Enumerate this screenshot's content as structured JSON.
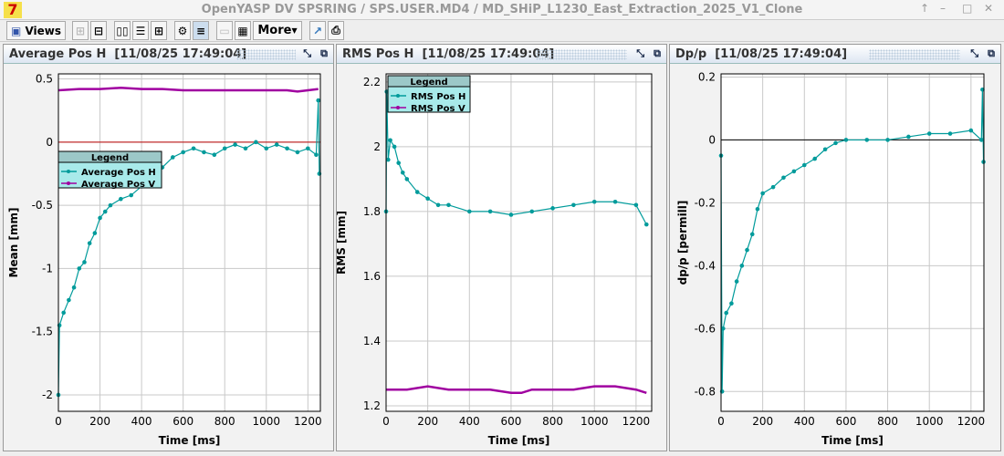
{
  "window": {
    "title": "OpenYASP DV SPSRING / SPS.USER.MD4 / MD_SHiP_L1230_East_Extraction_2025_V1_Clone",
    "controls": [
      "↑",
      "–",
      "□",
      "✕"
    ]
  },
  "toolbar": {
    "views_label": "Views",
    "more_label": "More"
  },
  "panels": [
    {
      "title": "Average Pos H",
      "timestamp": "[11/08/25 17:49:04]"
    },
    {
      "title": "RMS Pos H",
      "timestamp": "[11/08/25 17:49:04]"
    },
    {
      "title": "Dp/p",
      "timestamp": "[11/08/25 17:49:04]"
    }
  ],
  "chart_data": [
    {
      "type": "line",
      "xlabel": "Time [ms]",
      "ylabel": "Mean [mm]",
      "xlim": [
        0,
        1260
      ],
      "ylim": [
        -2.13,
        0.54
      ],
      "xticks": [
        0,
        200,
        400,
        600,
        800,
        1000,
        1200
      ],
      "yticks": [
        0.5,
        0,
        -0.5,
        -1,
        -1.5,
        -2
      ],
      "grid": true,
      "zero_line": true,
      "legend_title": "Legend",
      "legend_placement": "left",
      "series": [
        {
          "name": "Average Pos H",
          "color": "#009b9b",
          "x": [
            0,
            5,
            25,
            50,
            75,
            100,
            125,
            150,
            175,
            200,
            225,
            250,
            300,
            350,
            400,
            450,
            500,
            550,
            600,
            650,
            700,
            750,
            800,
            850,
            900,
            950,
            1000,
            1050,
            1100,
            1150,
            1200,
            1240,
            1250,
            1255
          ],
          "y": [
            -2.0,
            -1.45,
            -1.35,
            -1.25,
            -1.15,
            -1.0,
            -0.95,
            -0.8,
            -0.72,
            -0.6,
            -0.55,
            -0.5,
            -0.45,
            -0.42,
            -0.35,
            -0.3,
            -0.2,
            -0.12,
            -0.08,
            -0.05,
            -0.08,
            -0.1,
            -0.05,
            -0.02,
            -0.05,
            0.0,
            -0.05,
            -0.02,
            -0.05,
            -0.08,
            -0.05,
            -0.1,
            0.33,
            -0.25
          ]
        },
        {
          "name": "Average Pos V",
          "color": "#a000a0",
          "x": [
            0,
            100,
            200,
            300,
            400,
            500,
            600,
            700,
            800,
            900,
            1000,
            1100,
            1150,
            1200,
            1250
          ],
          "y": [
            0.41,
            0.42,
            0.42,
            0.43,
            0.42,
            0.42,
            0.41,
            0.41,
            0.41,
            0.41,
            0.41,
            0.41,
            0.4,
            0.41,
            0.42
          ]
        }
      ]
    },
    {
      "type": "line",
      "xlabel": "Time [ms]",
      "ylabel": "RMS [mm]",
      "xlim": [
        0,
        1275
      ],
      "ylim": [
        1.183,
        2.225
      ],
      "xticks": [
        0,
        200,
        400,
        600,
        800,
        1000,
        1200
      ],
      "yticks": [
        2.2,
        2,
        1.8,
        1.6,
        1.4,
        1.2
      ],
      "grid": true,
      "legend_title": "Legend",
      "legend_placement": "top-left",
      "series": [
        {
          "name": "RMS Pos H",
          "color": "#009b9b",
          "x": [
            0,
            3,
            10,
            20,
            40,
            60,
            80,
            100,
            150,
            200,
            250,
            300,
            400,
            500,
            600,
            700,
            800,
            900,
            1000,
            1100,
            1200,
            1250
          ],
          "y": [
            1.8,
            2.17,
            1.96,
            2.02,
            2.0,
            1.95,
            1.92,
            1.9,
            1.86,
            1.84,
            1.82,
            1.82,
            1.8,
            1.8,
            1.79,
            1.8,
            1.81,
            1.82,
            1.83,
            1.83,
            1.82,
            1.76
          ]
        },
        {
          "name": "RMS Pos V",
          "color": "#a000a0",
          "x": [
            0,
            100,
            200,
            300,
            400,
            500,
            600,
            650,
            700,
            800,
            900,
            1000,
            1100,
            1200,
            1250
          ],
          "y": [
            1.25,
            1.25,
            1.26,
            1.25,
            1.25,
            1.25,
            1.24,
            1.24,
            1.25,
            1.25,
            1.25,
            1.26,
            1.26,
            1.25,
            1.24
          ]
        }
      ]
    },
    {
      "type": "line",
      "xlabel": "Time [ms]",
      "ylabel": "dp/p [permill]",
      "xlim": [
        0,
        1262
      ],
      "ylim": [
        -0.863,
        0.21
      ],
      "xticks": [
        0,
        200,
        400,
        600,
        800,
        1000,
        1200
      ],
      "yticks": [
        0.2,
        0,
        -0.2,
        -0.4,
        -0.6,
        -0.8
      ],
      "grid": true,
      "zero_line": true,
      "series": [
        {
          "name": "",
          "color": "#009b9b",
          "x": [
            0,
            5,
            10,
            25,
            50,
            75,
            100,
            125,
            150,
            175,
            200,
            250,
            300,
            350,
            400,
            450,
            500,
            550,
            600,
            700,
            800,
            900,
            1000,
            1100,
            1200,
            1250,
            1255,
            1260
          ],
          "y": [
            -0.05,
            -0.8,
            -0.6,
            -0.55,
            -0.52,
            -0.45,
            -0.4,
            -0.35,
            -0.3,
            -0.22,
            -0.17,
            -0.15,
            -0.12,
            -0.1,
            -0.08,
            -0.06,
            -0.03,
            -0.01,
            0.0,
            0.0,
            0.0,
            0.01,
            0.02,
            0.02,
            0.03,
            0.0,
            0.16,
            -0.07
          ]
        }
      ]
    }
  ]
}
